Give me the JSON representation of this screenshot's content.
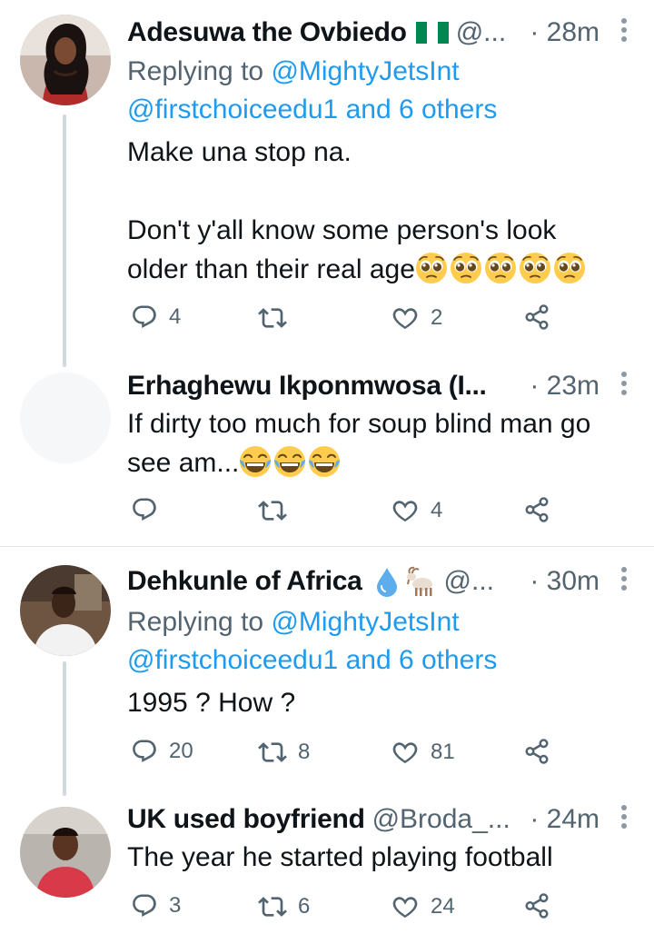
{
  "tweets": [
    {
      "name": "Adesuwa the Ovbiedo",
      "flag": "nigeria-flag",
      "handle": "@...",
      "time": "· 28m",
      "replying_prefix": "Replying to",
      "replying_user": "@MightyJetsInt",
      "replying_second": "@firstchoiceedu1 and 6 others",
      "text_line1": "Make una stop na.",
      "text_line2": "Don't y'all know some person's look",
      "text_line3": "older than their real age",
      "emoji": "pleading-face-emoji",
      "replies": "4",
      "retweets": "",
      "likes": "2"
    },
    {
      "name": "Erhaghewu Ikponmwosa (I...",
      "time": "· 23m",
      "text_line1": "If dirty too much for soup blind man go",
      "text_line2": "see am...",
      "emoji": "tears-of-joy-emoji",
      "replies": "",
      "retweets": "",
      "likes": "4"
    },
    {
      "name": "Dehkunle of Africa",
      "handle": "@...",
      "time": "· 30m",
      "replying_prefix": "Replying to",
      "replying_user": "@MightyJetsInt",
      "replying_second": "@firstchoiceedu1 and 6 others",
      "text_line1": "1995 ? How ?",
      "replies": "20",
      "retweets": "8",
      "likes": "81"
    },
    {
      "name": "UK used boyfriend",
      "handle": "@Broda_...",
      "time": "· 24m",
      "text_line1": "The year he started playing football",
      "replies": "3",
      "retweets": "6",
      "likes": "24"
    }
  ],
  "colors": {
    "link": "#1d9bf0",
    "secondary": "#536471",
    "line": "#cfd9de"
  }
}
